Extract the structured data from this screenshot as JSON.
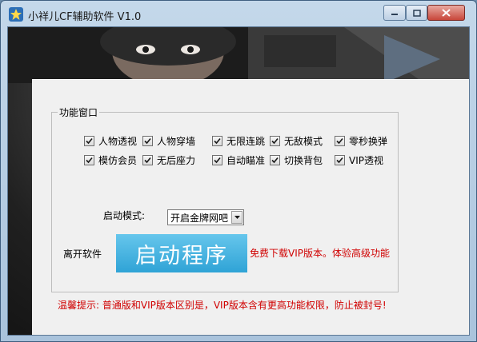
{
  "window": {
    "title": "小祥儿CF辅助软件 V1.0",
    "icon": "star-icon"
  },
  "colors": {
    "accent": "#39aade",
    "warning_text": "#d00000",
    "panel_bg": "#f0f0f0"
  },
  "features": {
    "legend": "功能窗口",
    "items": [
      {
        "label": "人物透视",
        "checked": true
      },
      {
        "label": "人物穿墙",
        "checked": true
      },
      {
        "label": "无限连跳",
        "checked": true
      },
      {
        "label": "无敌模式",
        "checked": true
      },
      {
        "label": "零秒换弹",
        "checked": true
      },
      {
        "label": "模仿会员",
        "checked": true
      },
      {
        "label": "无后座力",
        "checked": true
      },
      {
        "label": "自动瞄准",
        "checked": true
      },
      {
        "label": "切换背包",
        "checked": true
      },
      {
        "label": "VIP透视",
        "checked": true
      }
    ]
  },
  "launch": {
    "mode_label": "启动模式:",
    "mode_value": "开启金牌网吧",
    "leave_label": "离开软件",
    "start_button": "启动程序",
    "vip_text": "免费下载VIP版本。体验高级功能"
  },
  "tip": "温馨提示: 普通版和VIP版本区别是，VIP版本含有更高功能权限，防止被封号!"
}
